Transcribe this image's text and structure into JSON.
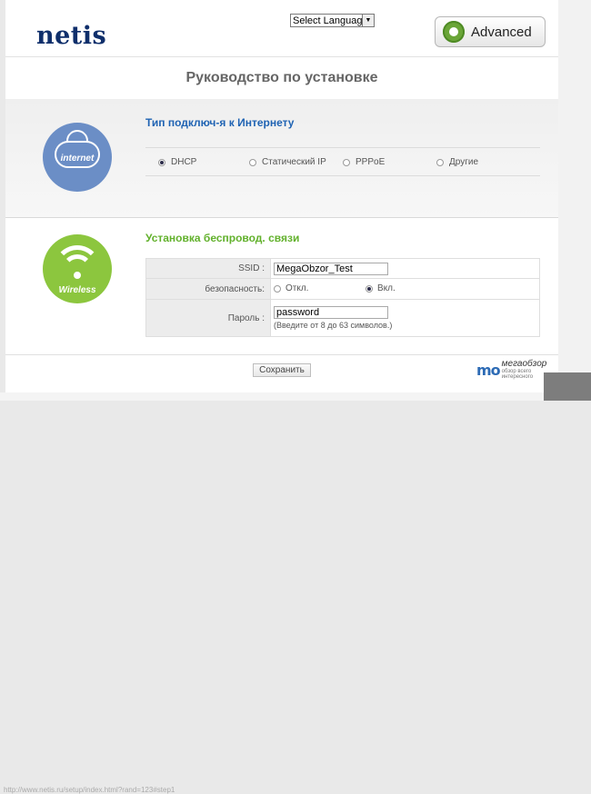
{
  "header": {
    "logo": "netis",
    "language_select": "Select Language",
    "advanced_label": "Advanced"
  },
  "title": "Руководство по установке",
  "internet": {
    "icon_label": "internet",
    "title": "Тип подключ-я к Интернету",
    "options": [
      {
        "label": "DHCP",
        "selected": true
      },
      {
        "label": "Статический IP",
        "selected": false
      },
      {
        "label": "PPPoE",
        "selected": false
      },
      {
        "label": "Другие",
        "selected": false
      }
    ]
  },
  "wireless": {
    "icon_label": "Wireless",
    "title": "Установка беспровод. связи",
    "ssid_label": "SSID :",
    "ssid_value": "MegaObzor_Test",
    "security_label": "безопасность:",
    "security_off": "Откл.",
    "security_on": "Вкл.",
    "security_selected": "on",
    "password_label": "Пароль :",
    "password_value": "password",
    "password_hint": "(Введите от 8 до 63 символов.)"
  },
  "save_label": "Сохранить",
  "watermark": {
    "mark": "mo",
    "text": "мегаобзор",
    "sub": "обзор всего интересного"
  },
  "status_bar": "http://www.netis.ru/setup/index.html?rand=123#step1",
  "colors": {
    "logo": "#0f2f6b",
    "internet_circle": "#6b8ec6",
    "wireless_circle": "#8cc63e",
    "internet_title": "#1f63b3",
    "wireless_title": "#62b12c",
    "advanced_gear": "#6aa537"
  }
}
